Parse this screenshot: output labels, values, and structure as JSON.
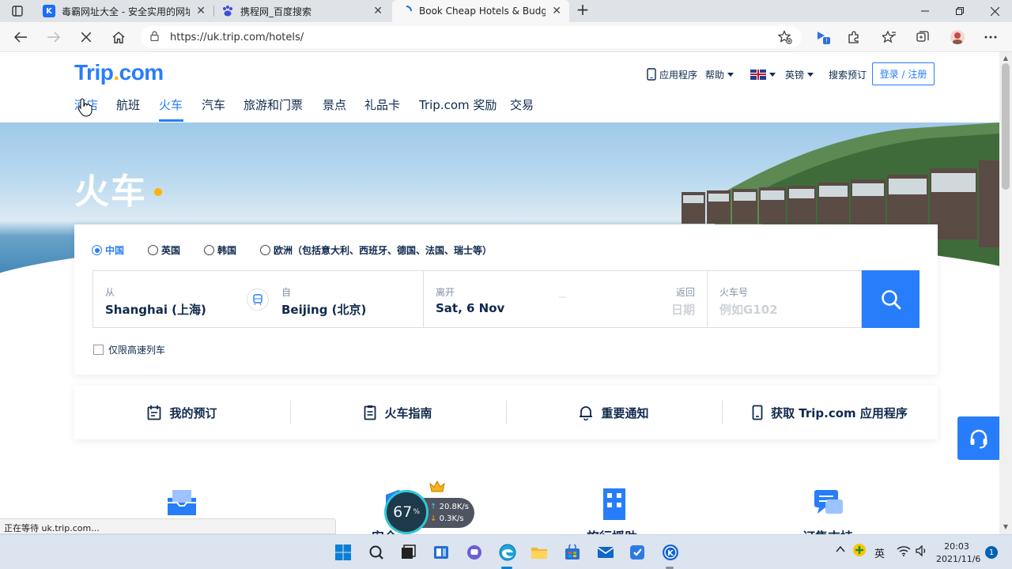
{
  "browser": {
    "tabs": [
      {
        "title": "毒霸网址大全 - 安全实用的网址导航",
        "close": "✕"
      },
      {
        "title": "携程网_百度搜索",
        "close": "✕"
      },
      {
        "title": "Book Cheap Hotels & Budget Accommodation",
        "close": "✕"
      }
    ],
    "new_tab": "+",
    "url": "https://uk.trip.com/hotels/",
    "status": "正在等待 uk.trip.com..."
  },
  "site": {
    "logo_main": "Trip",
    "logo_dot": ".",
    "logo_tld": "com",
    "top": {
      "app": "应用程序",
      "help": "帮助",
      "currency": "英镑",
      "search_bookings": "搜索预订",
      "login": "登录 / 注册"
    },
    "nav": [
      "酒店",
      "航班",
      "火车",
      "汽车",
      "旅游和门票",
      "景点",
      "礼品卡",
      "Trip.com 奖励",
      "交易"
    ],
    "hero_title": "火车"
  },
  "search": {
    "regions": [
      "中国",
      "英国",
      "韩国",
      "欧洲（包括意大利、西班牙、德国、法国、瑞士等）"
    ],
    "from_label": "从",
    "from_value": "Shanghai (上海)",
    "to_label": "自",
    "to_value": "Beijing (北京)",
    "depart_label": "离开",
    "depart_value": "Sat, 6 Nov",
    "return_label": "返回",
    "return_placeholder": "日期",
    "dash": "—",
    "train_label": "火车号",
    "train_placeholder": "例如G102",
    "highspeed_label": "仅限高速列车"
  },
  "quick_links": [
    "我的预订",
    "火车指南",
    "重要通知",
    "获取 Trip.com 应用程序"
  ],
  "features": [
    "安全",
    "旅行援助",
    "订售支持"
  ],
  "speed_widget": {
    "percent": "67",
    "unit": "%",
    "up": "20.8",
    "down": "0.3",
    "rate_unit": "K/s"
  },
  "taskbar": {
    "ime": "英",
    "time": "20:03",
    "date": "2021/11/6",
    "notifications": "1"
  },
  "colors": {
    "brand": "#287dfa",
    "accent": "#ffb400",
    "text": "#0f294d"
  }
}
